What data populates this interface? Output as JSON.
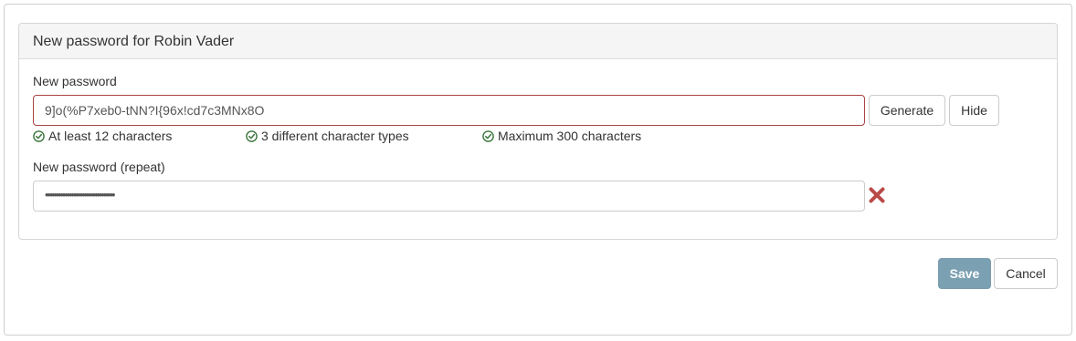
{
  "panel": {
    "title": "New password for Robin Vader"
  },
  "new_password": {
    "label": "New password",
    "value": "9]o(%P7xeb0-tNN?I{96x!cd7c3MNx8O",
    "generate_label": "Generate",
    "hide_label": "Hide"
  },
  "requirements": [
    {
      "icon": "check-circle-icon",
      "label": "At least 12 characters",
      "status": "ok"
    },
    {
      "icon": "check-circle-icon",
      "label": "3 different character types",
      "status": "ok"
    },
    {
      "icon": "check-circle-icon",
      "label": "Maximum 300 characters",
      "status": "ok"
    }
  ],
  "repeat_password": {
    "label": "New password (repeat)",
    "masked_value": "••••••••••••••••••••••••••••••••",
    "status_icon": "close-x-icon",
    "status": "mismatch"
  },
  "actions": {
    "save_label": "Save",
    "cancel_label": "Cancel"
  },
  "colors": {
    "error_border": "#a94442",
    "success_green": "#3c763d",
    "error_red": "#b94a48",
    "primary_button": "#7ba0b2"
  }
}
